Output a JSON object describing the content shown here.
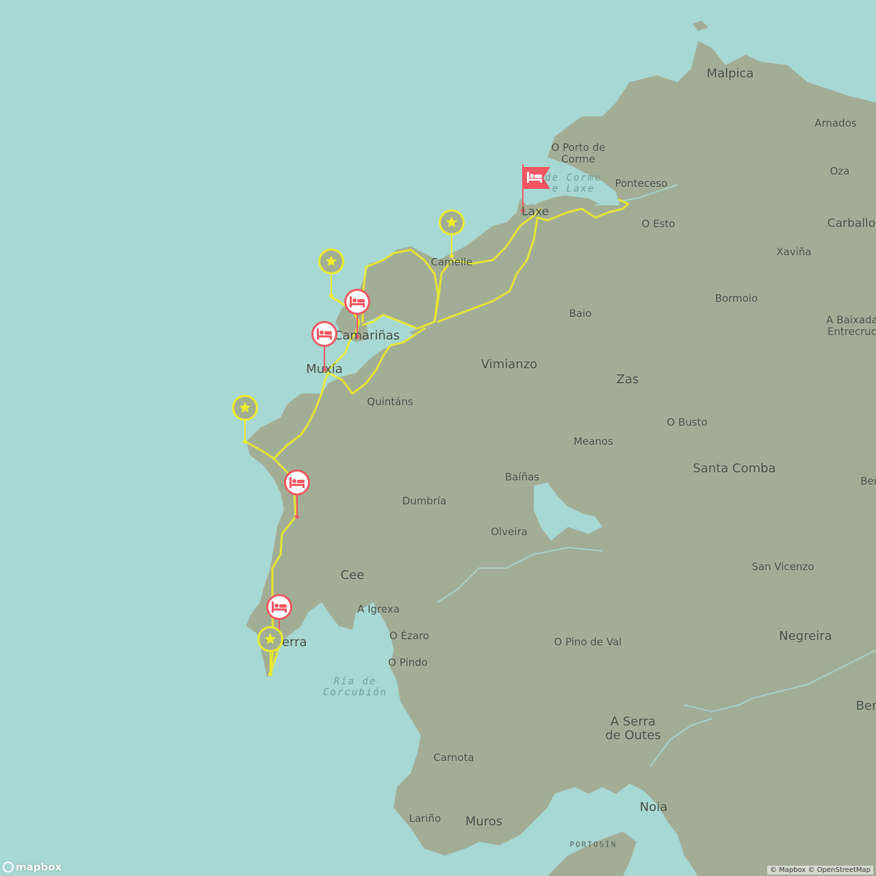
{
  "map": {
    "colors": {
      "sea": "#a8d8d4",
      "land": "#a2ad96",
      "route": "#ecec2c",
      "poi": "#ecec2c",
      "stay": "#f25560"
    },
    "places": [
      {
        "name": "Malpica",
        "size": "l"
      },
      {
        "name": "Arnados",
        "size": "s"
      },
      {
        "name": "O Porto de\nCorme",
        "size": "s"
      },
      {
        "name": "Oza",
        "size": "s"
      },
      {
        "name": "Ponteceso",
        "size": "s"
      },
      {
        "name": "Laxe",
        "size": "m"
      },
      {
        "name": "O Esto",
        "size": "s"
      },
      {
        "name": "Carballo",
        "size": "m"
      },
      {
        "name": "Xaviña",
        "size": "s"
      },
      {
        "name": "Camelle",
        "size": "s"
      },
      {
        "name": "Bormoio",
        "size": "s"
      },
      {
        "name": "Baio",
        "size": "s"
      },
      {
        "name": "A Baixada\nEntrecruc",
        "size": "s"
      },
      {
        "name": "Camariñas",
        "size": "l"
      },
      {
        "name": "Muxía",
        "size": "l"
      },
      {
        "name": "Vimianzo",
        "size": "l"
      },
      {
        "name": "Zas",
        "size": "l"
      },
      {
        "name": "Quintáns",
        "size": "s"
      },
      {
        "name": "O Busto",
        "size": "s"
      },
      {
        "name": "Meanos",
        "size": "s"
      },
      {
        "name": "Santa Comba",
        "size": "l"
      },
      {
        "name": "Baíñas",
        "size": "s"
      },
      {
        "name": "Ber",
        "size": "s"
      },
      {
        "name": "Dumbría",
        "size": "s"
      },
      {
        "name": "Olveira",
        "size": "s"
      },
      {
        "name": "San Vicenzo",
        "size": "s"
      },
      {
        "name": "Cee",
        "size": "l"
      },
      {
        "name": "A Igrexa",
        "size": "s"
      },
      {
        "name": "Fisterra",
        "size": "l"
      },
      {
        "name": "O Ézaro",
        "size": "s"
      },
      {
        "name": "O Pino de Val",
        "size": "s"
      },
      {
        "name": "Negreira",
        "size": "l"
      },
      {
        "name": "O Pindo",
        "size": "s"
      },
      {
        "name": "Ber",
        "size": "l"
      },
      {
        "name": "A Serra\nde Outes",
        "size": "l"
      },
      {
        "name": "Carnota",
        "size": "s"
      },
      {
        "name": "Noia",
        "size": "l"
      },
      {
        "name": "Lariño",
        "size": "s"
      },
      {
        "name": "Muros",
        "size": "l"
      }
    ],
    "water_labels": [
      {
        "name": "Ría de\nCorcubión"
      },
      {
        "name": "de Corme\ne Laxe"
      },
      {
        "name": "PORTOSÍN"
      }
    ],
    "markers": [
      {
        "kind": "start-flag",
        "icon": "bed-icon"
      },
      {
        "kind": "star",
        "icon": "star-icon"
      },
      {
        "kind": "star",
        "icon": "star-icon"
      },
      {
        "kind": "stay",
        "icon": "bed-icon"
      },
      {
        "kind": "stay",
        "icon": "bed-icon"
      },
      {
        "kind": "star",
        "icon": "star-icon"
      },
      {
        "kind": "stay",
        "icon": "bed-icon"
      },
      {
        "kind": "stay",
        "icon": "bed-icon"
      },
      {
        "kind": "star",
        "icon": "star-icon"
      }
    ]
  },
  "attribution": "© Mapbox © OpenStreetMap",
  "logo": "mapbox"
}
